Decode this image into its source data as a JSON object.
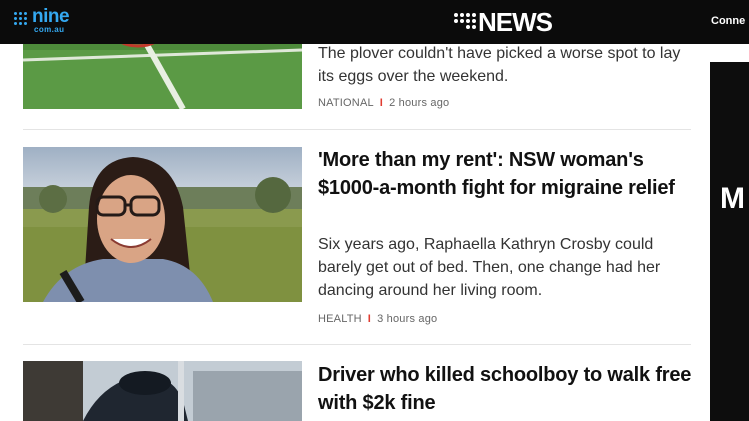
{
  "header": {
    "nine_brand": "nine",
    "nine_domain": "com.au",
    "news_brand": "NEWS",
    "connect_label": "Conne"
  },
  "ad": {
    "letter": "M"
  },
  "articles": [
    {
      "summary": "The plover couldn't have picked a worse spot to lay its eggs over the weekend.",
      "category": "NATIONAL",
      "time": "2 hours ago"
    },
    {
      "headline": "'More than my rent': NSW woman's $1000-a-month fight for migraine relief",
      "summary": "Six years ago, Raphaella Kathryn Crosby could barely get out of bed. Then, one change had her dancing around her living room.",
      "category": "HEALTH",
      "time": "3 hours ago"
    },
    {
      "headline": "Driver who killed schoolboy to walk free with $2k fine"
    }
  ],
  "meta_separator": "I",
  "colors": {
    "header_bg": "#0b0b0b",
    "nine_blue": "#34a8f0",
    "separator_red": "#e03c31"
  }
}
